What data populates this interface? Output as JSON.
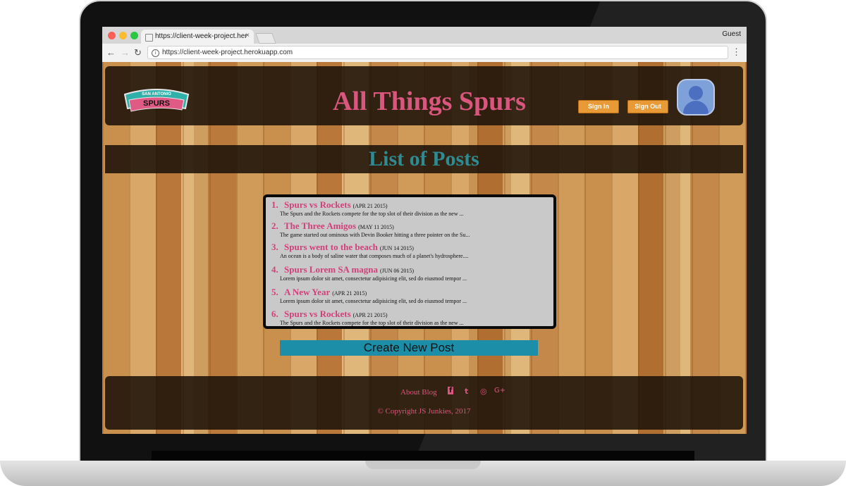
{
  "browser": {
    "tab_title": "https://client-week-project.her",
    "tab_close": "×",
    "url": "https://client-week-project.herokuapp.com",
    "profile": "Guest",
    "back": "←",
    "forward": "→",
    "reload": "↻",
    "info": "i",
    "menu": "⋮"
  },
  "header": {
    "logo_text_top": "SAN ANTONIO",
    "logo_text_main": "SPURS",
    "title": "All Things Spurs",
    "sign_in": "Sign In",
    "sign_out": "Sign Out"
  },
  "section": {
    "title": "List of Posts"
  },
  "posts": [
    {
      "num": "1.",
      "title": "Spurs vs Rockets",
      "date": "(APR 21 2015)",
      "excerpt": "The Spurs and the Rockets compete for the top slot of their division as the new ..."
    },
    {
      "num": "2.",
      "title": "The Three Amigos",
      "date": "(MAY 11 2015)",
      "excerpt": "The game started out ominous with Devin Booker hitting a three pointer on the Su..."
    },
    {
      "num": "3.",
      "title": "Spurs went to the beach",
      "date": "(JUN 14 2015)",
      "excerpt": "An ocean is a body of saline water that composes much of a planet's hydrosphere...."
    },
    {
      "num": "4.",
      "title": "Spurs Lorem SA magna",
      "date": "(JUN 06 2015)",
      "excerpt": "Lorem ipsum dolor sit amet, consectetur adipisicing elit, sed do eiusmod tempor ..."
    },
    {
      "num": "5.",
      "title": "A New Year",
      "date": "(APR 21 2015)",
      "excerpt": "Lorem ipsum dolor sit amet, consectetur adipisicing elit, sed do eiusmod tempor ..."
    },
    {
      "num": "6.",
      "title": "Spurs vs Rockets",
      "date": "(APR 21 2015)",
      "excerpt": "The Spurs and the Rockets compete for the top slot of their division as the new ..."
    }
  ],
  "create_button": "Create New Post",
  "footer": {
    "about": "About Blog",
    "facebook_icon": "f",
    "twitter_icon": "t",
    "instagram_icon": "◎",
    "google_plus_icon": "G+",
    "copyright": "© Copyright JS Junkies, 2017"
  },
  "colors": {
    "accent_pink": "#d9577f",
    "teal": "#2f8a92",
    "button_orange": "#e79a36",
    "create_blue": "#1d8ea8"
  }
}
